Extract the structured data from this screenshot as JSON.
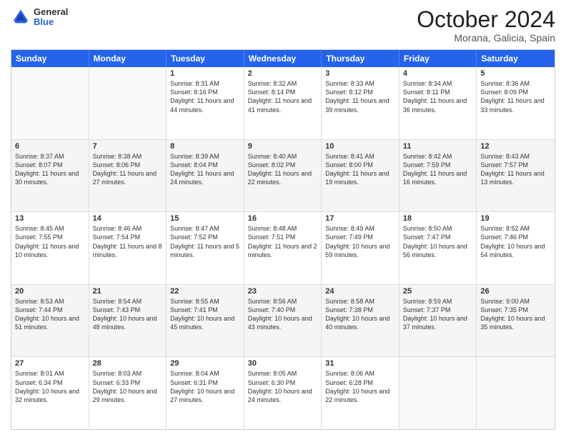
{
  "header": {
    "logo": {
      "general": "General",
      "blue": "Blue"
    },
    "title": "October 2024",
    "location": "Morana, Galicia, Spain"
  },
  "days": [
    "Sunday",
    "Monday",
    "Tuesday",
    "Wednesday",
    "Thursday",
    "Friday",
    "Saturday"
  ],
  "rows": [
    [
      {
        "day": "",
        "content": ""
      },
      {
        "day": "",
        "content": ""
      },
      {
        "day": "1",
        "content": "Sunrise: 8:31 AM\nSunset: 8:16 PM\nDaylight: 11 hours and 44 minutes."
      },
      {
        "day": "2",
        "content": "Sunrise: 8:32 AM\nSunset: 8:14 PM\nDaylight: 11 hours and 41 minutes."
      },
      {
        "day": "3",
        "content": "Sunrise: 8:33 AM\nSunset: 8:12 PM\nDaylight: 11 hours and 39 minutes."
      },
      {
        "day": "4",
        "content": "Sunrise: 8:34 AM\nSunset: 8:11 PM\nDaylight: 11 hours and 36 minutes."
      },
      {
        "day": "5",
        "content": "Sunrise: 8:36 AM\nSunset: 8:09 PM\nDaylight: 11 hours and 33 minutes."
      }
    ],
    [
      {
        "day": "6",
        "content": "Sunrise: 8:37 AM\nSunset: 8:07 PM\nDaylight: 11 hours and 30 minutes."
      },
      {
        "day": "7",
        "content": "Sunrise: 8:38 AM\nSunset: 8:06 PM\nDaylight: 11 hours and 27 minutes."
      },
      {
        "day": "8",
        "content": "Sunrise: 8:39 AM\nSunset: 8:04 PM\nDaylight: 11 hours and 24 minutes."
      },
      {
        "day": "9",
        "content": "Sunrise: 8:40 AM\nSunset: 8:02 PM\nDaylight: 11 hours and 22 minutes."
      },
      {
        "day": "10",
        "content": "Sunrise: 8:41 AM\nSunset: 8:00 PM\nDaylight: 11 hours and 19 minutes."
      },
      {
        "day": "11",
        "content": "Sunrise: 8:42 AM\nSunset: 7:59 PM\nDaylight: 11 hours and 16 minutes."
      },
      {
        "day": "12",
        "content": "Sunrise: 8:43 AM\nSunset: 7:57 PM\nDaylight: 11 hours and 13 minutes."
      }
    ],
    [
      {
        "day": "13",
        "content": "Sunrise: 8:45 AM\nSunset: 7:55 PM\nDaylight: 11 hours and 10 minutes."
      },
      {
        "day": "14",
        "content": "Sunrise: 8:46 AM\nSunset: 7:54 PM\nDaylight: 11 hours and 8 minutes."
      },
      {
        "day": "15",
        "content": "Sunrise: 8:47 AM\nSunset: 7:52 PM\nDaylight: 11 hours and 5 minutes."
      },
      {
        "day": "16",
        "content": "Sunrise: 8:48 AM\nSunset: 7:51 PM\nDaylight: 11 hours and 2 minutes."
      },
      {
        "day": "17",
        "content": "Sunrise: 8:49 AM\nSunset: 7:49 PM\nDaylight: 10 hours and 59 minutes."
      },
      {
        "day": "18",
        "content": "Sunrise: 8:50 AM\nSunset: 7:47 PM\nDaylight: 10 hours and 56 minutes."
      },
      {
        "day": "19",
        "content": "Sunrise: 8:52 AM\nSunset: 7:46 PM\nDaylight: 10 hours and 54 minutes."
      }
    ],
    [
      {
        "day": "20",
        "content": "Sunrise: 8:53 AM\nSunset: 7:44 PM\nDaylight: 10 hours and 51 minutes."
      },
      {
        "day": "21",
        "content": "Sunrise: 8:54 AM\nSunset: 7:43 PM\nDaylight: 10 hours and 48 minutes."
      },
      {
        "day": "22",
        "content": "Sunrise: 8:55 AM\nSunset: 7:41 PM\nDaylight: 10 hours and 45 minutes."
      },
      {
        "day": "23",
        "content": "Sunrise: 8:56 AM\nSunset: 7:40 PM\nDaylight: 10 hours and 43 minutes."
      },
      {
        "day": "24",
        "content": "Sunrise: 8:58 AM\nSunset: 7:38 PM\nDaylight: 10 hours and 40 minutes."
      },
      {
        "day": "25",
        "content": "Sunrise: 8:59 AM\nSunset: 7:37 PM\nDaylight: 10 hours and 37 minutes."
      },
      {
        "day": "26",
        "content": "Sunrise: 9:00 AM\nSunset: 7:35 PM\nDaylight: 10 hours and 35 minutes."
      }
    ],
    [
      {
        "day": "27",
        "content": "Sunrise: 8:01 AM\nSunset: 6:34 PM\nDaylight: 10 hours and 32 minutes."
      },
      {
        "day": "28",
        "content": "Sunrise: 8:03 AM\nSunset: 6:33 PM\nDaylight: 10 hours and 29 minutes."
      },
      {
        "day": "29",
        "content": "Sunrise: 8:04 AM\nSunset: 6:31 PM\nDaylight: 10 hours and 27 minutes."
      },
      {
        "day": "30",
        "content": "Sunrise: 8:05 AM\nSunset: 6:30 PM\nDaylight: 10 hours and 24 minutes."
      },
      {
        "day": "31",
        "content": "Sunrise: 8:06 AM\nSunset: 6:28 PM\nDaylight: 10 hours and 22 minutes."
      },
      {
        "day": "",
        "content": ""
      },
      {
        "day": "",
        "content": ""
      }
    ]
  ]
}
